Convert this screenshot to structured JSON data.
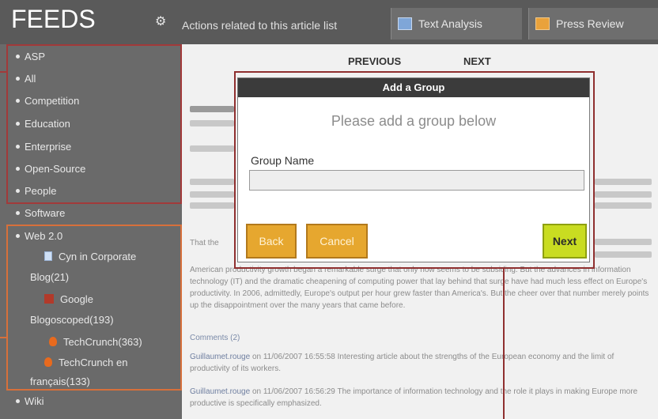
{
  "topbar": {
    "title": "FEEDS",
    "actions_label": "Actions related to this article list",
    "text_analysis": "Text Analysis",
    "press_review": "Press Review"
  },
  "sidebar": {
    "items": [
      {
        "label": "ASP"
      },
      {
        "label": "All"
      },
      {
        "label": "Competition"
      },
      {
        "label": "Education"
      },
      {
        "label": "Enterprise"
      },
      {
        "label": "Open-Source"
      },
      {
        "label": "People"
      },
      {
        "label": "Software"
      },
      {
        "label": "Web 2.0"
      },
      {
        "label": "Wiki"
      }
    ],
    "web20_children": [
      {
        "label_line1": "Cyn in Corporate",
        "label_line2": "Blog(21)"
      },
      {
        "label_line1": "Google",
        "label_line2": "Blogoscoped(193)"
      },
      {
        "label_line1": "TechCrunch(363)",
        "label_line2": ""
      },
      {
        "label_line1": "TechCrunch en",
        "label_line2": "français(133)"
      }
    ]
  },
  "content": {
    "previous": "PREVIOUS",
    "next": "NEXT",
    "para1_start": "That the",
    "para2": "American productivity growth began a remarkable surge that only now seems to be subsiding. But the advances in information technology (IT) and the dramatic cheapening of computing power that lay behind that surge have had much less effect on Europe's productivity. In 2006, admittedly, Europe's output per hour grew faster than America's. But the cheer over that number merely points up the disappointment over the many years that came before.",
    "comments": "Comments (2)",
    "comment1_author": "Guillaumet.rouge",
    "comment1_date": "on 11/06/2007 16:55:58",
    "comment1_text": "Interesting article about the strengths of the European economy and the limit of productivity of its workers.",
    "comment2_author": "Guillaumet.rouge",
    "comment2_date": "on 11/06/2007 16:56:29",
    "comment2_text": "The importance of information technology and the role it plays in making Europe more productive is specifically emphasized."
  },
  "dialog": {
    "title": "Add a Group",
    "subtitle": "Please add a group below",
    "field_label": "Group Name",
    "field_value": "",
    "back": "Back",
    "cancel": "Cancel",
    "next": "Next"
  }
}
